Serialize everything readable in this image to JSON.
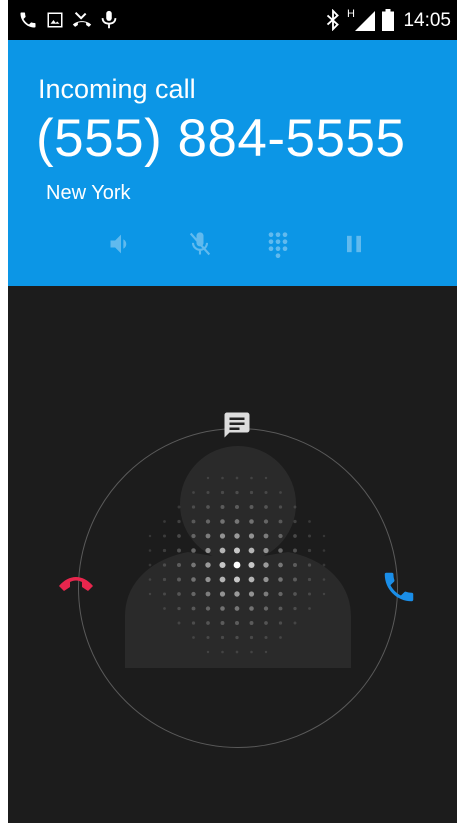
{
  "status_bar": {
    "time": "14:05",
    "network_type": "H",
    "left_icons": [
      "call-icon",
      "gallery-icon",
      "missed-call-icon",
      "voicemail-icon"
    ],
    "right_icons": [
      "bluetooth-icon",
      "signal-icon",
      "battery-icon"
    ]
  },
  "call": {
    "status": "Incoming call",
    "number": "(555) 884-5555",
    "location": "New York"
  },
  "controls": [
    "speaker-icon",
    "mute-icon",
    "dialpad-icon",
    "hold-icon"
  ],
  "colors": {
    "header": "#0c96e6",
    "background": "#1c1c1c",
    "decline": "#e8264d",
    "answer": "#1a8ee8"
  }
}
